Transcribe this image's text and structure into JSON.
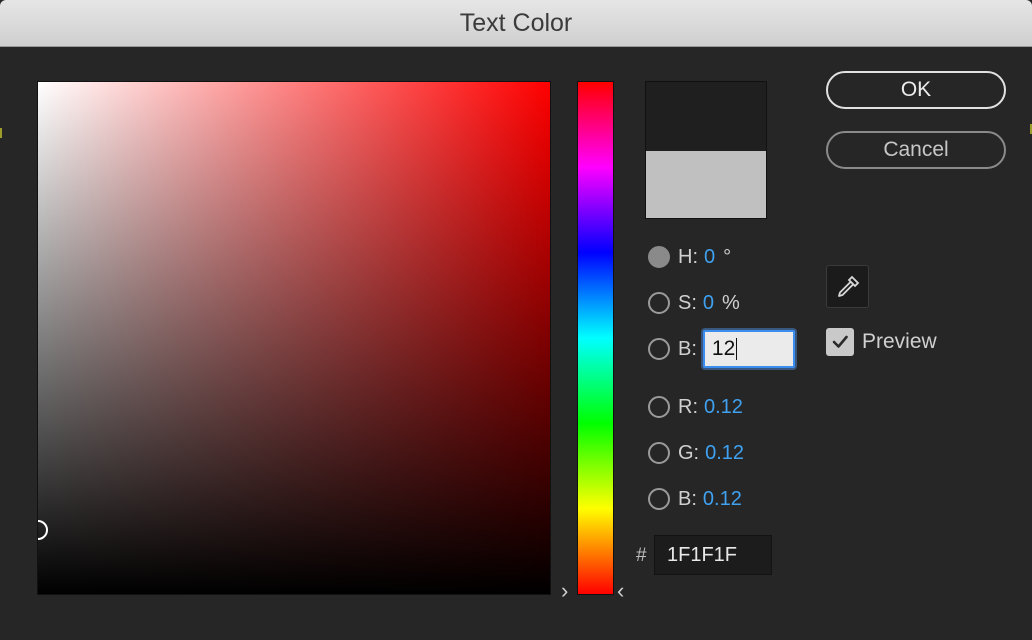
{
  "window": {
    "title": "Text Color"
  },
  "fields": {
    "hue": {
      "label": "H:",
      "value": "0",
      "unit": "°"
    },
    "saturation": {
      "label": "S:",
      "value": "0",
      "unit": "%"
    },
    "brightness": {
      "label": "B:",
      "value": "12"
    },
    "red": {
      "label": "R:",
      "value": "0.12"
    },
    "green": {
      "label": "G:",
      "value": "0.12"
    },
    "blue": {
      "label": "B:",
      "value": "0.12"
    }
  },
  "hex": {
    "label": "#",
    "value": "1F1F1F"
  },
  "buttons": {
    "ok": "OK",
    "cancel": "Cancel"
  },
  "preview": {
    "label": "Preview",
    "checked": true
  },
  "swatch": {
    "new_color": "#1F1F1F",
    "original_color": "#C0C0C0"
  },
  "hue_slider": {
    "arrow_left": "›",
    "arrow_right": "‹"
  },
  "colors": {
    "value_blue": "#3fa1f0",
    "focus_blue": "#3b8ef0"
  },
  "icons": {
    "eyedropper": "eyedropper-icon",
    "check": "check-icon"
  }
}
